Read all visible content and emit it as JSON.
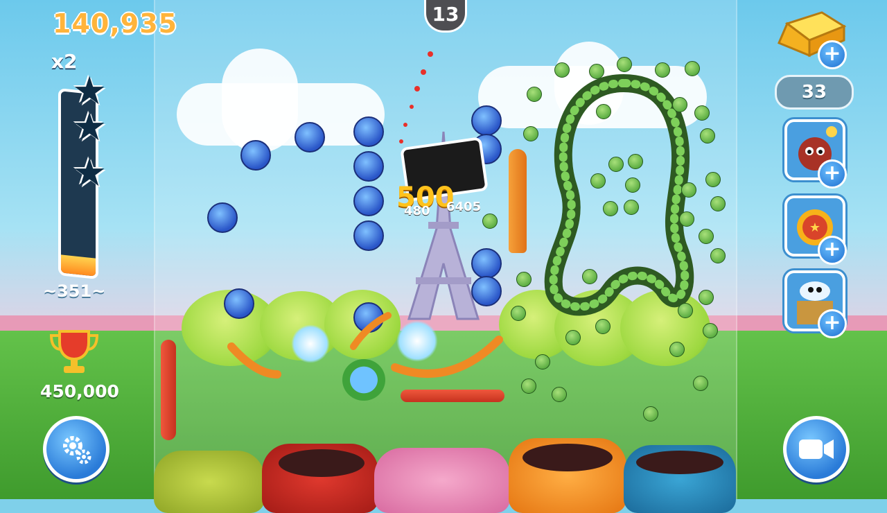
{
  "hud": {
    "score": "140,935",
    "multiplier": "x2",
    "star_meter": {
      "stars": 3,
      "fill_fraction": 0.1
    },
    "target_score": "~351~",
    "trophy_score": "450,000"
  },
  "launcher": {
    "balls_left": "13"
  },
  "floating_scores": {
    "big": "500",
    "small_left": "480",
    "small_right": "6405"
  },
  "currency": {
    "gold_count": "33",
    "add_label": "+"
  },
  "powerups": [
    {
      "name": "bomb-powerup",
      "add_label": "+"
    },
    {
      "name": "fireball-powerup",
      "add_label": "+"
    },
    {
      "name": "ghost-box-powerup",
      "add_label": "+"
    }
  ],
  "icons": {
    "settings": "gear-icon",
    "replay": "video-camera-icon",
    "trophy": "trophy-icon",
    "gold": "gold-bar-icon"
  },
  "colors": {
    "score": "#ffb43b",
    "meter_bg": "#1e3950",
    "meter_fill": "#ff8a1f",
    "button_blue": "#2a7bd8"
  }
}
